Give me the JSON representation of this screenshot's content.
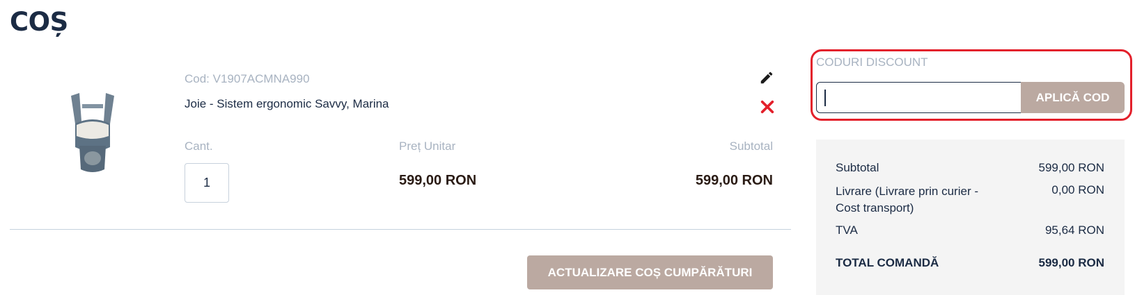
{
  "page": {
    "title": "COȘ"
  },
  "item": {
    "code": "Cod: V1907ACMNA990",
    "name": "Joie - Sistem ergonomic Savvy, Marina",
    "quantity": "1",
    "unit_price": "599,00 RON",
    "subtotal": "599,00 RON",
    "image_icon": "baby-carrier-image",
    "edit_icon": "pencil-icon",
    "remove_icon": "close-icon"
  },
  "columns": {
    "qty_label": "Cant.",
    "price_label": "Preț Unitar",
    "subtotal_label": "Subtotal"
  },
  "actions": {
    "update_cart_label": "ACTUALIZARE COȘ CUMPĂRĂTURI"
  },
  "discount": {
    "title": "CODURI DISCOUNT",
    "input_value": "",
    "apply_label": "APLICĂ COD"
  },
  "summary": {
    "subtotal_label": "Subtotal",
    "subtotal_value": "599,00 RON",
    "shipping_label": "Livrare (Livrare prin curier - Cost transport)",
    "shipping_value": "0,00 RON",
    "tax_label": "TVA",
    "tax_value": "95,64 RON",
    "total_label": "TOTAL COMANDĂ",
    "total_value": "599,00 RON"
  },
  "colors": {
    "heading": "#1b2b44",
    "muted_label": "#a8b3c1",
    "button_bg": "#bba9a1",
    "highlight_border": "#e3202b",
    "remove_icon": "#e3202b",
    "summary_bg": "#f4f4f4"
  }
}
